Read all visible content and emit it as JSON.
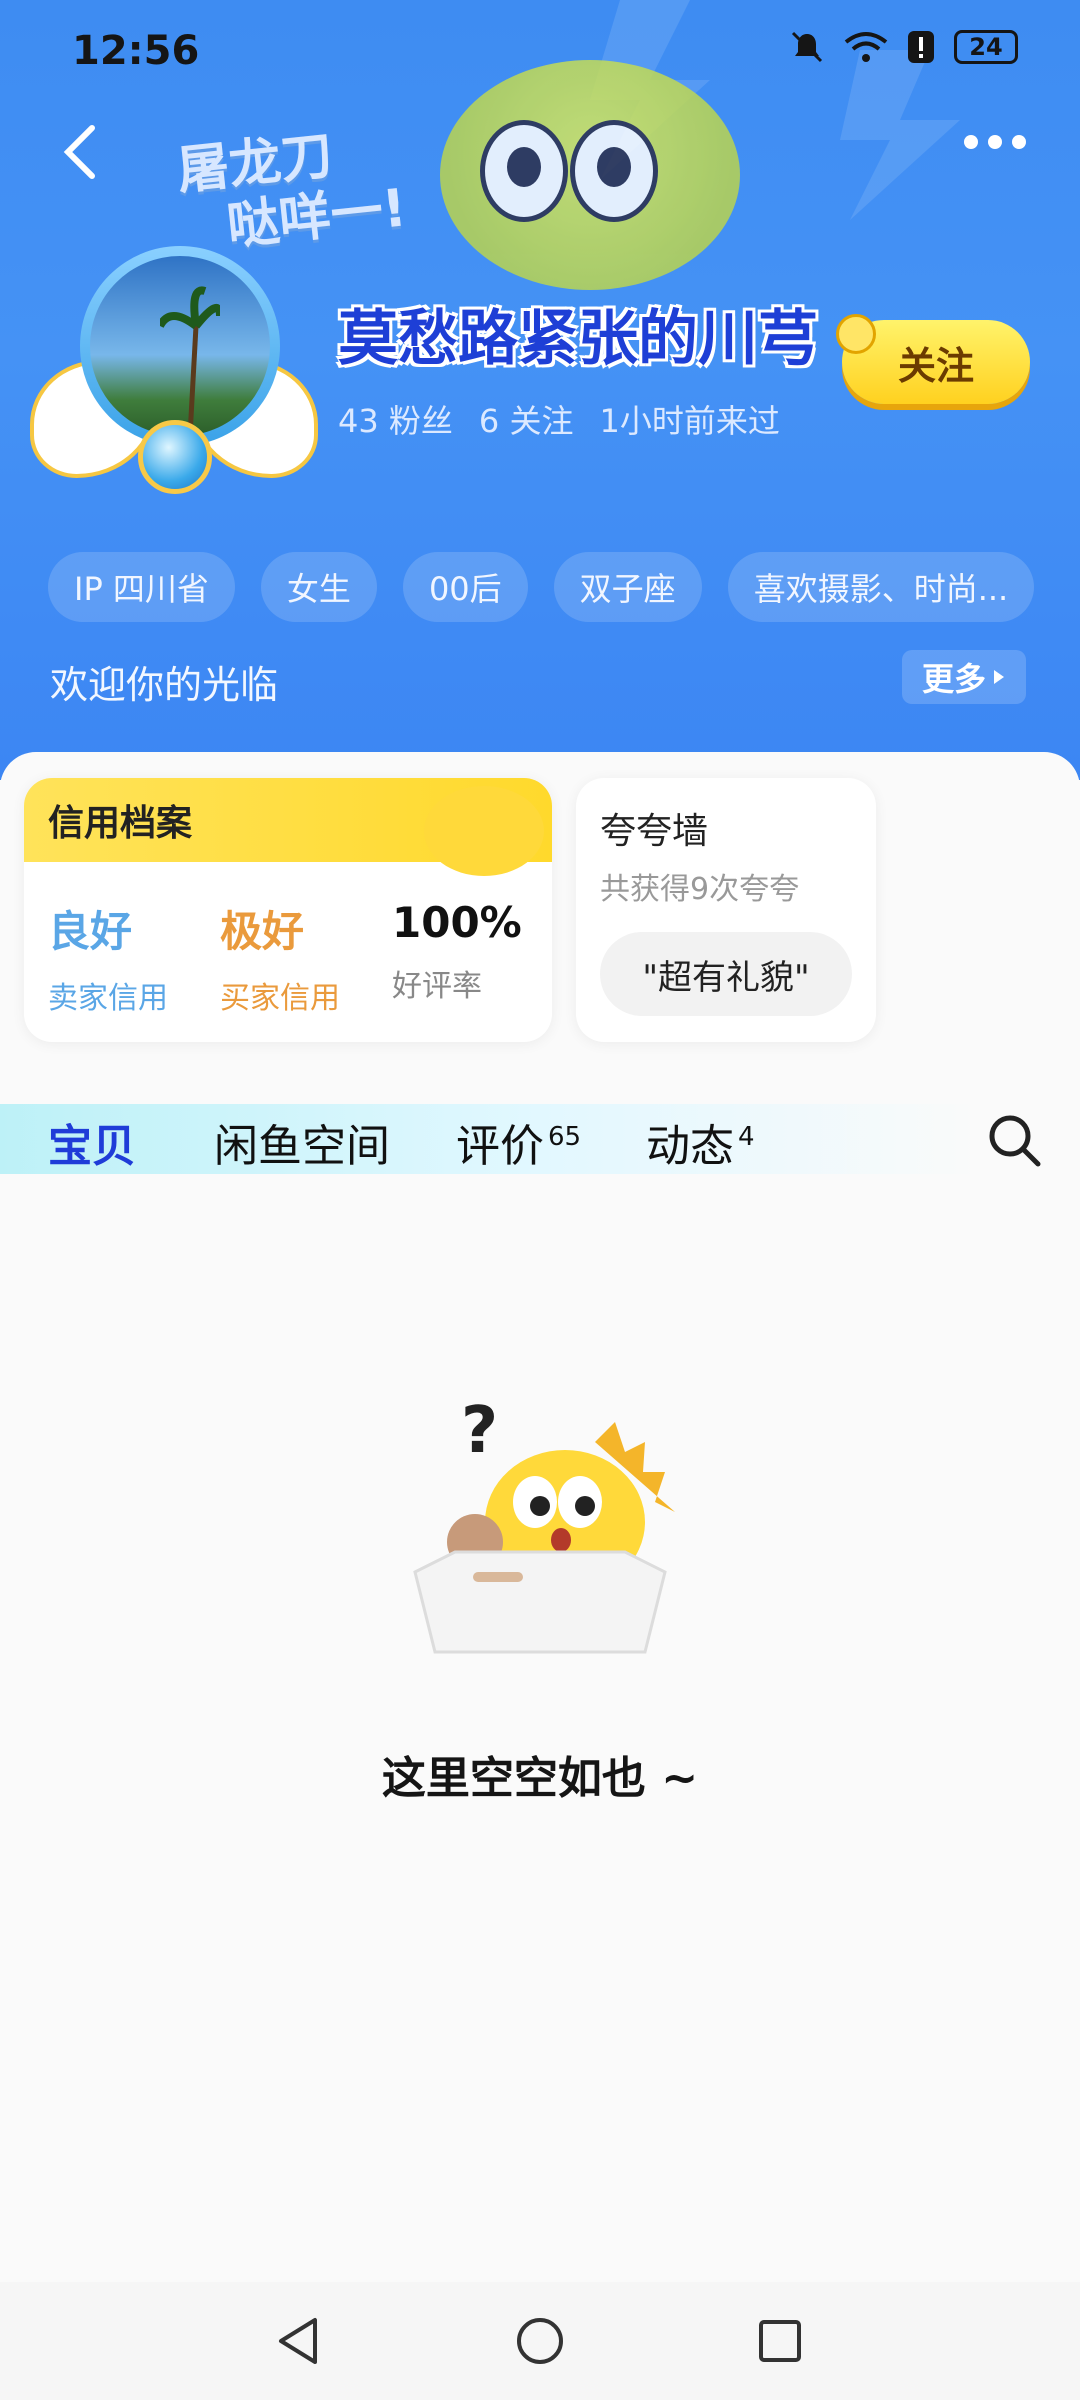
{
  "status_bar": {
    "time": "12:56",
    "battery": "24"
  },
  "header": {
    "slogan_line1": "屠龙刀",
    "slogan_line2": "哒咩一!",
    "username": "莫愁路紧张的川芎",
    "stats": {
      "fans": "43 粉丝",
      "following": "6 关注",
      "last_seen": "1小时前来过"
    },
    "follow_label": "关注",
    "tags": [
      "IP 四川省",
      "女生",
      "00后",
      "双子座",
      "喜欢摄影、时尚..."
    ],
    "welcome": "欢迎你的光临",
    "more_label": "更多"
  },
  "credit": {
    "title": "信用档案",
    "items": [
      {
        "value": "良好",
        "label": "卖家信用",
        "color": "#5aa6e6"
      },
      {
        "value": "极好",
        "label": "买家信用",
        "color": "#ea9a3c"
      },
      {
        "value": "100%",
        "label": "好评率",
        "color": "#111111"
      }
    ]
  },
  "praise": {
    "title": "夸夸墙",
    "subtitle": "共获得9次夸夸",
    "chip": "\"超有礼貌\""
  },
  "tabs": [
    {
      "label": "宝贝",
      "badge": ""
    },
    {
      "label": "闲鱼空间",
      "badge": ""
    },
    {
      "label": "评价",
      "badge": "65"
    },
    {
      "label": "动态",
      "badge": "4"
    }
  ],
  "empty_text": "这里空空如也 ~",
  "colors": {
    "brand_blue": "#3e8cf2",
    "accent_yellow": "#ffd93a",
    "active_tab": "#1f3cd8"
  }
}
